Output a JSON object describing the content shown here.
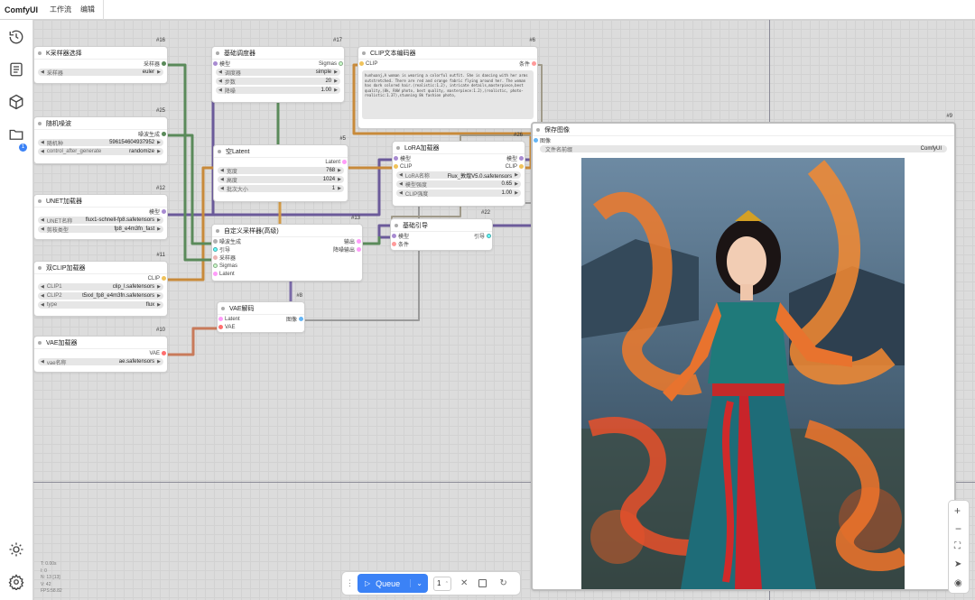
{
  "app": {
    "title": "ComfyUI",
    "menu": [
      "工作流",
      "编辑"
    ]
  },
  "colors": {
    "model": "#a88bd1",
    "clip": "#f0c35b",
    "conditioning": "#ff9a9a",
    "latent": "#ff9cf9",
    "vae": "#ff6e6e",
    "image": "#64b5f6",
    "sampler": "#ecb4b4",
    "sigmas": "#cdffcd",
    "noise": "#b0b0b0",
    "guider": "#66ffff",
    "wire_green": "#5a8a5a",
    "wire_purple": "#7a6aa8",
    "wire_orange": "#c8833a"
  },
  "sidebar": {
    "badge": "1"
  },
  "nodes": {
    "ksampler_select": {
      "id": "#16",
      "title": "K采样器选择",
      "out": "采样器",
      "w0_label": "采样器",
      "w0_value": "euler"
    },
    "random_noise": {
      "id": "#25",
      "title": "随机噪波",
      "out": "噪波生成",
      "w0_label": "随机种",
      "w0_value": "596154604937952",
      "w1_label": "control_after_generate",
      "w1_value": "randomize"
    },
    "unet_loader": {
      "id": "#12",
      "title": "UNET加载器",
      "out": "模型",
      "w0_label": "UNET名称",
      "w0_value": "flux1-schnell-fp8.safetensors",
      "w1_label": "剪枝类型",
      "w1_value": "fp8_e4m3fn_fast"
    },
    "dual_clip": {
      "id": "#11",
      "title": "双CLIP加载器",
      "out": "CLIP",
      "w0_label": "CLIP1",
      "w0_value": "clip_l.safetensors",
      "w1_label": "CLIP2",
      "w1_value": "t5xxl_fp8_e4m3fn.safetensors",
      "w2_label": "type",
      "w2_value": "flux"
    },
    "vae_loader": {
      "id": "#10",
      "title": "VAE加载器",
      "out": "VAE",
      "w0_label": "vae名称",
      "w0_value": "ae.safetensors"
    },
    "basic_scheduler": {
      "id": "#17",
      "title": "基础调度器",
      "in": "模型",
      "out": "Sigmas",
      "w0_label": "调度器",
      "w0_value": "simple",
      "w1_label": "步数",
      "w1_value": "20",
      "w2_label": "降噪",
      "w2_value": "1.00"
    },
    "empty_latent": {
      "id": "#5",
      "title": "空Latent",
      "out": "Latent",
      "w0_label": "宽度",
      "w0_value": "768",
      "w1_label": "高度",
      "w1_value": "1024",
      "w2_label": "批次大小",
      "w2_value": "1"
    },
    "custom_sampler": {
      "id": "#13",
      "title": "自定义采样器(高级)",
      "in0": "噪波生成",
      "in1": "引导",
      "in2": "采样器",
      "in3": "Sigmas",
      "in4": "Latent",
      "out0": "输出",
      "out1": "降噪输出"
    },
    "vae_decode": {
      "id": "#8",
      "title": "VAE解码",
      "in0": "Latent",
      "in1": "VAE",
      "out": "图像"
    },
    "clip_encode": {
      "id": "#6",
      "title": "CLIP文本编码器",
      "in": "CLIP",
      "out": "条件",
      "text": "hunhuanj,A woman is wearing a colorful outfit. She is dancing with her arms outstretched. There are red and orange fabric flying around her. The woman has dark colored hair.(realistic:1.2), intricate details,masterpiece,best quality,(8k, RAW photo, best quality, masterpiece:1.2),(realistic, photo-realistic:1.37),stunning 8k fashion photo,"
    },
    "lora_loader": {
      "id": "#26",
      "title": "LoRA加载器",
      "in0": "模型",
      "in1": "CLIP",
      "out0": "模型",
      "out1": "CLIP",
      "w0_label": "LoRA名称",
      "w0_value": "Flux_敦煌V5.0.safetensors",
      "w1_label": "模型强度",
      "w1_value": "0.65",
      "w2_label": "CLIP强度",
      "w2_value": "1.00"
    },
    "basic_guider": {
      "id": "#22",
      "title": "基础引导",
      "in0": "模型",
      "in1": "条件",
      "out": "引导"
    },
    "save_image": {
      "id": "#9",
      "title": "保存图像",
      "in": "图像",
      "w0_label": "文件名前缀",
      "w0_value": "ComfyUI"
    }
  },
  "queue": {
    "label": "Queue",
    "count": "1"
  },
  "stats": [
    "T: 0.00s",
    "I: 0",
    "N: 13 [13]",
    "V: 42",
    "FPS:58.82"
  ]
}
